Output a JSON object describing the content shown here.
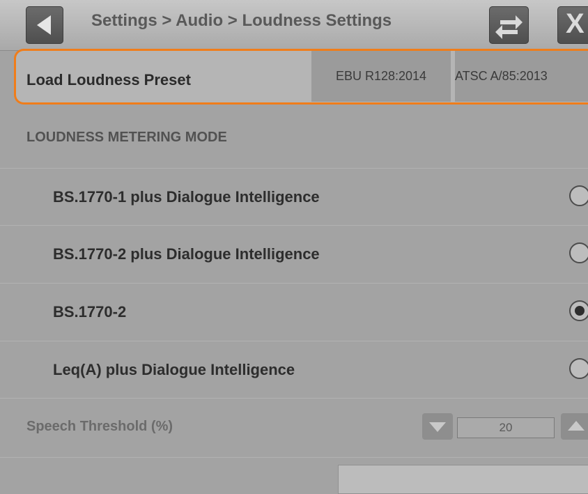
{
  "header": {
    "breadcrumb": "Settings > Audio > Loudness Settings",
    "back_icon": "back-arrow-icon",
    "swap_icon": "swap-arrows-icon",
    "close_label": "X"
  },
  "preset": {
    "label": "Load Loudness Preset",
    "buttons": [
      "EBU R128:2014",
      "ATSC A/85:2013"
    ]
  },
  "section": {
    "title": "LOUDNESS METERING MODE"
  },
  "modes": [
    {
      "label": "BS.1770-1 plus Dialogue Intelligence",
      "selected": false
    },
    {
      "label": "BS.1770-2 plus Dialogue Intelligence",
      "selected": false
    },
    {
      "label": "BS.1770-2",
      "selected": true
    },
    {
      "label": "Leq(A) plus Dialogue Intelligence",
      "selected": false
    }
  ],
  "speech_threshold": {
    "label": "Speech Threshold (%)",
    "value": "20"
  },
  "colors": {
    "highlight_border": "#f07d1a",
    "background": "#a3a3a3"
  }
}
